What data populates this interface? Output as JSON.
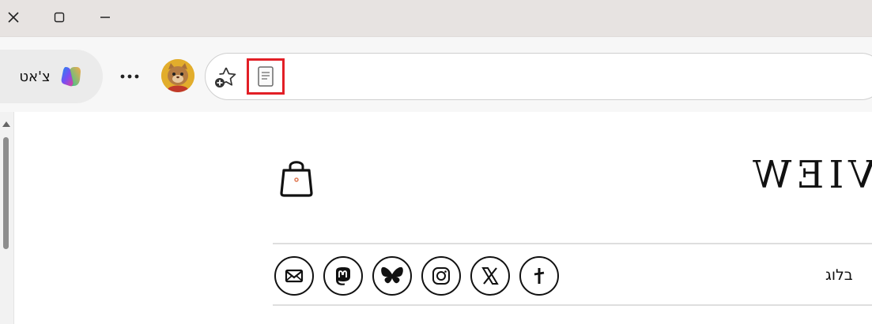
{
  "window": {
    "controls": {
      "close_icon": "close-icon",
      "maximize_icon": "maximize-icon",
      "minimize_icon": "minimize-icon"
    }
  },
  "toolbar": {
    "chat_label": "צ'אט",
    "more_icon": "more-horizontal-icon",
    "favorites_icon": "add-to-favorites-icon",
    "reader_icon": "immersive-reader-icon",
    "reader_highlight_color": "#e21f26"
  },
  "page": {
    "logo_text": "VIEW",
    "blog_label": "בלוג",
    "social_icons": [
      "mail-icon",
      "mastodon-icon",
      "bluesky-icon",
      "instagram-icon",
      "x-icon",
      "threads-icon"
    ]
  },
  "colors": {
    "titlebar": "#e7e3e1",
    "toolbar": "#f7f7f7",
    "avatar": "#e2ad2c"
  }
}
